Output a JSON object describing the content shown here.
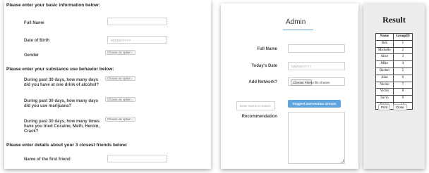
{
  "form": {
    "basic_header": "Please enter your basic information below:",
    "full_name_label": "Full Name",
    "dob_label": "Date of Birth",
    "dob_placeholder": "MM/DD/YYYY",
    "gender_label": "Gender",
    "select_option": "Choose an option ↕",
    "substance_header": "Please enter your substance use behavior below:",
    "q_alcohol": "During past 30 days, how many days did you have at one drink of alcohol?",
    "q_marijuana": "During past 30 days, how many days did you use marijuana?",
    "q_hard_drugs": "During past 30 days, how many times have you tried Cocaine, Meth, Heroin, Crack?",
    "friends_header": "Please enter details about your 3 closest friends below:",
    "first_friend_label": "Name of the first friend"
  },
  "admin": {
    "title": "Admin",
    "full_name_label": "Full Name",
    "todays_date_label": "Today's Date",
    "date_placeholder": "MM/DD/YYYY",
    "add_network_label": "Add Network?",
    "choose_file_label": "Choose File",
    "no_file_text": "No file chosen",
    "search_placeholder": "Enter Name to search",
    "suggest_button": "Suggest Intervention Groups",
    "recommendation_label": "Recommendation"
  },
  "result": {
    "title": "Result",
    "columns": [
      "Name",
      "GroupID"
    ],
    "rows": [
      [
        "Bob",
        "1"
      ],
      [
        "Michelle",
        "2"
      ],
      [
        "Alice",
        "3"
      ],
      [
        "Mike",
        "4"
      ],
      [
        "Rachel",
        "5"
      ],
      [
        "John",
        "6"
      ],
      [
        "Nicole",
        "7"
      ],
      [
        "Victor",
        "8"
      ],
      [
        "Savio",
        "9"
      ],
      [
        "Roger",
        "10"
      ]
    ],
    "print_label": "Print",
    "close_label": "Close"
  }
}
